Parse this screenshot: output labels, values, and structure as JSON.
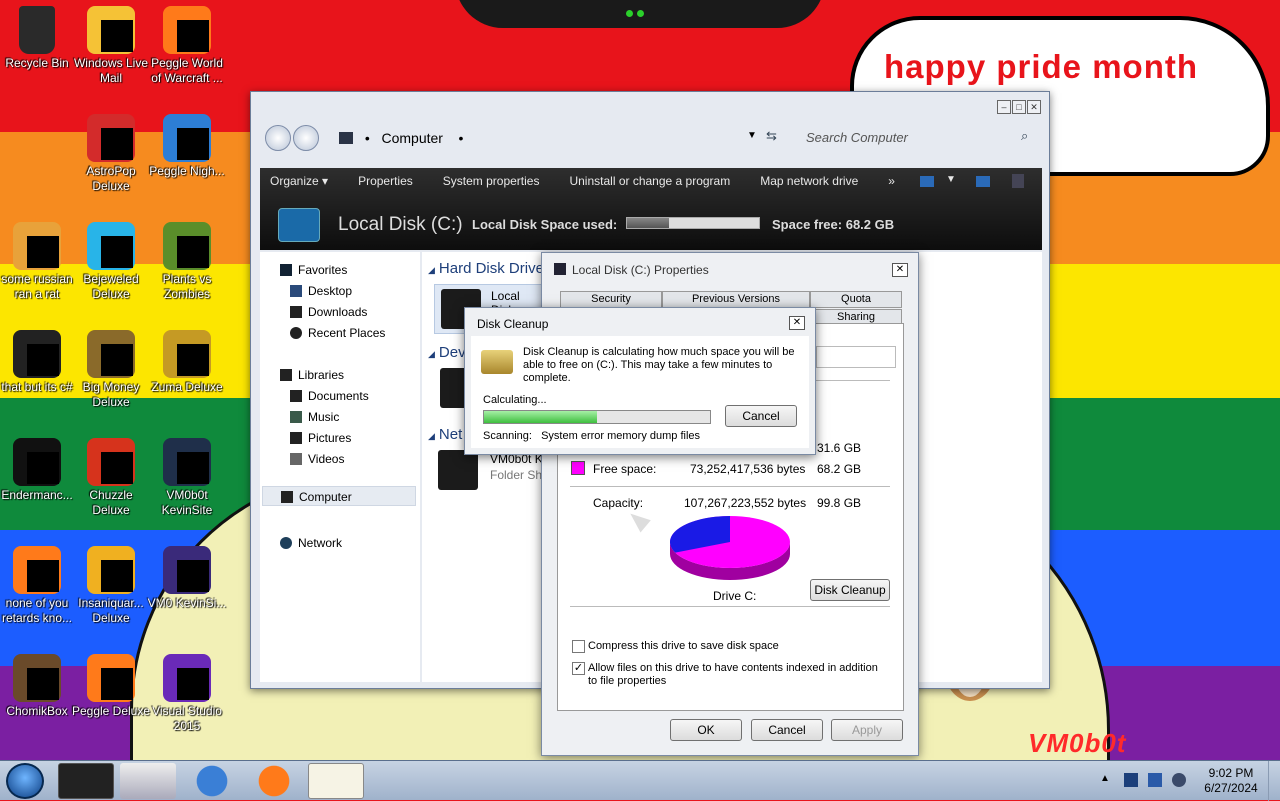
{
  "wallpaper": {
    "stripe_colors": [
      "#e8141b",
      "#f68b1f",
      "#fce600",
      "#0f8a3c",
      "#1c5dff",
      "#7b1fa2"
    ],
    "bubble_text": "happy pride month",
    "watermark": "VM0b0t"
  },
  "desktop_icons": [
    {
      "label": "Recycle Bin",
      "icon": "recycle-bin-icon"
    },
    {
      "label": "Windows Live Mail",
      "icon": "mail-icon"
    },
    {
      "label": "Peggle World of Warcraft ...",
      "icon": "peggle-icon"
    },
    {
      "label": "AstroPop Deluxe",
      "icon": "astropop-icon"
    },
    {
      "label": "Peggle Nigh...",
      "icon": "peggle-nights-icon"
    },
    {
      "label": "some russian ran a rat",
      "icon": "file-icon"
    },
    {
      "label": "Bejeweled Deluxe",
      "icon": "bejeweled-icon"
    },
    {
      "label": "Plants vs Zombies",
      "icon": "pvz-icon"
    },
    {
      "label": "that but its c#",
      "icon": "file-icon"
    },
    {
      "label": "Big Money Deluxe",
      "icon": "bigmoney-icon"
    },
    {
      "label": "Zuma Deluxe",
      "icon": "zuma-icon"
    },
    {
      "label": "Endermanc...",
      "icon": "terminal-icon"
    },
    {
      "label": "Chuzzle Deluxe",
      "icon": "chuzzle-icon"
    },
    {
      "label": "VM0b0t KevinSite",
      "icon": "site-icon"
    },
    {
      "label": "none of you retards kno...",
      "icon": "firefox-file-icon"
    },
    {
      "label": "Insaniquar... Deluxe",
      "icon": "insaniquarium-icon"
    },
    {
      "label": "VM0 KevinSi...",
      "icon": "site-icon"
    },
    {
      "label": "ChomikBox",
      "icon": "chomikbox-icon"
    },
    {
      "label": "Peggle Deluxe",
      "icon": "peggle-icon"
    },
    {
      "label": "Visual Studio 2015",
      "icon": "visual-studio-icon"
    }
  ],
  "explorer": {
    "address": "Computer",
    "search_placeholder": "Search Computer",
    "toolbar": [
      "Organize ▾",
      "Properties",
      "System properties",
      "Uninstall or change a program",
      "Map network drive",
      "»"
    ],
    "drive_title": "Local Disk (C:)",
    "drive_label": "Local Disk",
    "space_used_label": "Space used:",
    "space_used_fraction": 0.32,
    "space_free_label": "Space free:",
    "space_free_value": "68.2 GB",
    "nav": {
      "favorites": "Favorites",
      "desktop": "Desktop",
      "downloads": "Downloads",
      "recent": "Recent Places",
      "libraries": "Libraries",
      "documents": "Documents",
      "music": "Music",
      "pictures": "Pictures",
      "videos": "Videos",
      "computer": "Computer",
      "network": "Network"
    },
    "groups": {
      "hdd": "Hard Disk Drive",
      "devices": "Dev",
      "network": "Net",
      "hdd_item": "Local Disk",
      "net_item_title": "VM0b0t K",
      "net_item_sub": "Folder Sh"
    }
  },
  "properties": {
    "title": "Local Disk (C:) Properties",
    "tabs_row1": [
      "Security",
      "Previous Versions",
      "Quota"
    ],
    "tabs_row2": [
      "Sharing"
    ],
    "used_value": "31.6 GB",
    "free_label": "Free space:",
    "free_bytes": "73,252,417,536 bytes",
    "free_gb": "68.2 GB",
    "capacity_label": "Capacity:",
    "capacity_bytes": "107,267,223,552 bytes",
    "capacity_gb": "99.8 GB",
    "drive_label": "Drive C:",
    "cleanup_button": "Disk Cleanup",
    "compress_label": "Compress this drive to save disk space",
    "index_label": "Allow files on this drive to have contents indexed in addition to file properties",
    "used_color": "#1a1ae6",
    "free_color": "#ff00ff",
    "used_fraction": 0.317,
    "ok": "OK",
    "cancel": "Cancel",
    "apply": "Apply"
  },
  "disk_cleanup": {
    "title": "Disk Cleanup",
    "message": "Disk Cleanup is calculating how much space you will be able to free on  (C:). This may take a few minutes to complete.",
    "calculating": "Calculating...",
    "progress": 0.5,
    "cancel": "Cancel",
    "scanning": "Scanning:   System error memory dump files"
  },
  "taskbar": {
    "time": "9:02 PM",
    "date": "6/27/2024"
  }
}
